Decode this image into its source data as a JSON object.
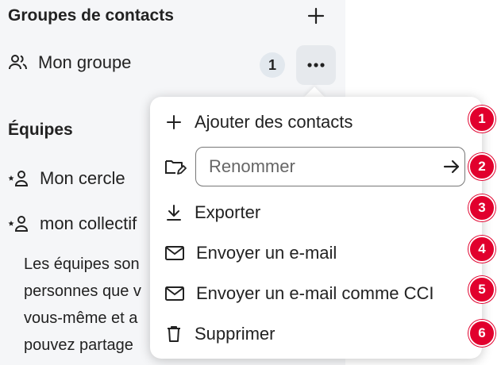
{
  "sidebar": {
    "contact_groups_title": "Groupes de contacts",
    "groups": [
      {
        "label": "Mon groupe",
        "count": "1"
      }
    ],
    "teams_title": "Équipes",
    "teams": [
      {
        "label": "Mon cercle"
      },
      {
        "label": "mon collectif"
      }
    ],
    "description_lines": [
      "Les équipes son",
      "personnes que v",
      "vous-même et a",
      "pouvez partage"
    ]
  },
  "menu": {
    "add_contacts": "Ajouter des contacts",
    "rename_placeholder": "Renommer",
    "export": "Exporter",
    "send_email": "Envoyer un e-mail",
    "send_email_bcc": "Envoyer un e-mail comme CCI",
    "delete": "Supprimer"
  },
  "markers": [
    "1",
    "2",
    "3",
    "4",
    "5",
    "6"
  ],
  "colors": {
    "marker": "#e1002d",
    "sidebar_bg": "#f5f6f8",
    "badge_bg": "#e2e8ee"
  }
}
